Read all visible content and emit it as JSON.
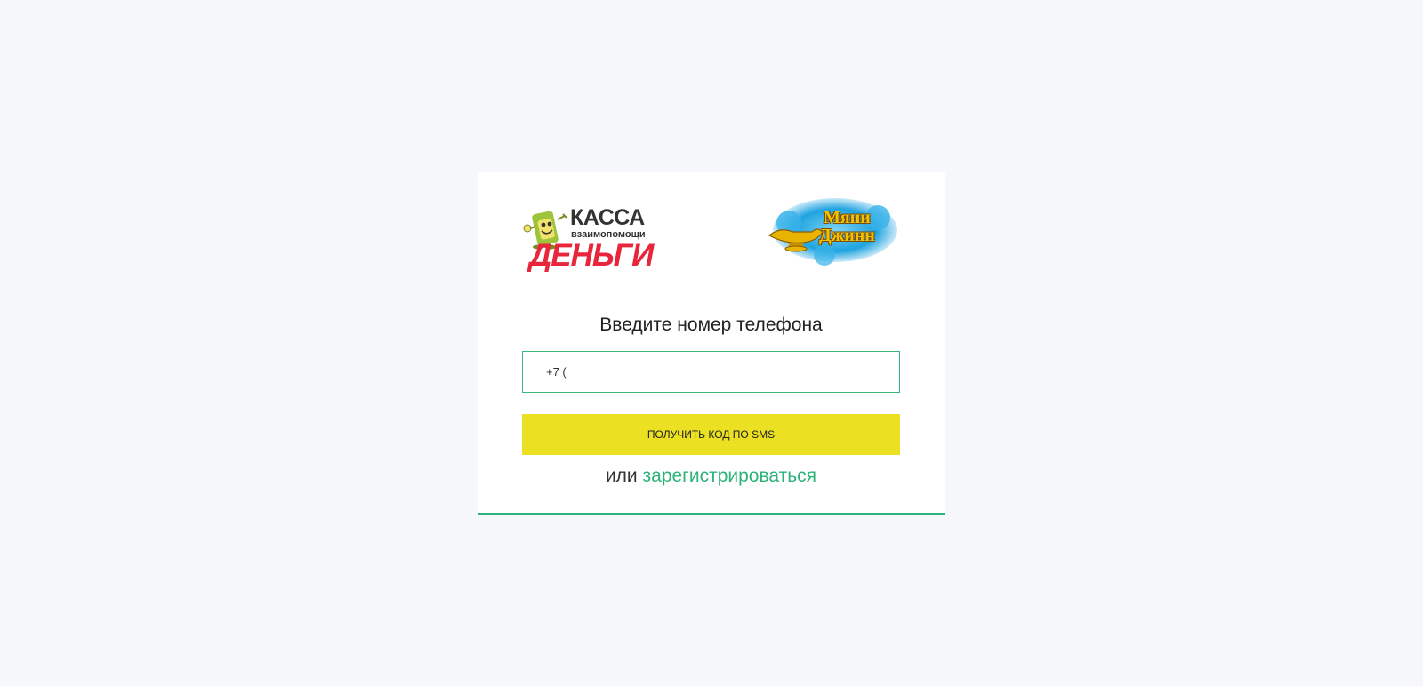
{
  "logos": {
    "left": {
      "title": "КАССА",
      "subtitle": "взаимопомощи",
      "brand": "ДЕНЬГИ",
      "mascot_icon": "cash-mascot-icon"
    },
    "right": {
      "line1": "Мяни",
      "line2": "Джинн",
      "lamp_icon": "magic-lamp-icon"
    }
  },
  "form": {
    "title": "Введите номер телефона",
    "phone_value": "+7 (",
    "submit_label": "ПОЛУЧИТЬ КОД ПО SMS",
    "alt_prefix": "или",
    "register_link": "зарегистрироваться"
  },
  "colors": {
    "background": "#f5f7fa",
    "accent_green": "#2db37a",
    "button_yellow": "#ebe022",
    "brand_red": "#e8253b"
  }
}
